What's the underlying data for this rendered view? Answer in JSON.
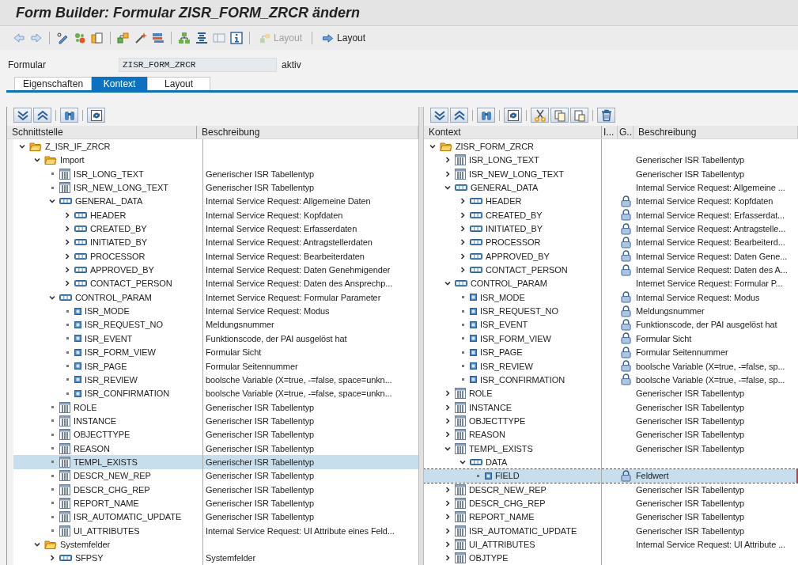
{
  "window": {
    "title": "Form Builder: Formular ZISR_FORM_ZRCR ändern"
  },
  "toolbar": {
    "buttons": [
      {
        "label": "Layout",
        "disabled": true
      },
      {
        "label": "Layout",
        "disabled": false
      }
    ]
  },
  "form": {
    "label": "Formular",
    "value": "ZISR_FORM_ZRCR",
    "status": "aktiv"
  },
  "tabs": [
    {
      "label": "Eigenschaften",
      "selected": false
    },
    {
      "label": "Kontext",
      "selected": true
    },
    {
      "label": "Layout",
      "selected": false
    }
  ],
  "interface_tree": {
    "columns": [
      "Schnittstelle",
      "Beschreibung"
    ],
    "nodes": [
      {
        "label": "Z_ISR_IF_ZRCR",
        "kind": "folder",
        "expandable": true,
        "expanded": true,
        "selected": false,
        "children": [
          {
            "label": "Import",
            "kind": "folder",
            "expandable": true,
            "expanded": true,
            "selected": false,
            "children": [
              {
                "label": "ISR_LONG_TEXT",
                "kind": "table",
                "expandable": false,
                "selected": false,
                "description": "Generischer ISR Tabellentyp"
              },
              {
                "label": "ISR_NEW_LONG_TEXT",
                "kind": "table",
                "expandable": false,
                "selected": false,
                "description": "Generischer ISR Tabellentyp"
              },
              {
                "label": "GENERAL_DATA",
                "kind": "structure",
                "expandable": true,
                "expanded": true,
                "selected": false,
                "description": "Internal Service Request: Allgemeine Daten",
                "children": [
                  {
                    "label": "HEADER",
                    "kind": "structure",
                    "expandable": true,
                    "expanded": false,
                    "selected": false,
                    "description": "Internal Service Request: Kopfdaten"
                  },
                  {
                    "label": "CREATED_BY",
                    "kind": "structure",
                    "expandable": true,
                    "expanded": false,
                    "selected": false,
                    "description": "Internal Service Request: Erfasserdaten"
                  },
                  {
                    "label": "INITIATED_BY",
                    "kind": "structure",
                    "expandable": true,
                    "expanded": false,
                    "selected": false,
                    "description": "Internal Service Request: Antragstellerdaten"
                  },
                  {
                    "label": "PROCESSOR",
                    "kind": "structure",
                    "expandable": true,
                    "expanded": false,
                    "selected": false,
                    "description": "Internal Service Request: Bearbeiterdaten"
                  },
                  {
                    "label": "APPROVED_BY",
                    "kind": "structure",
                    "expandable": true,
                    "expanded": false,
                    "selected": false,
                    "description": "Internal Service Request: Daten Genehmigender"
                  },
                  {
                    "label": "CONTACT_PERSON",
                    "kind": "structure",
                    "expandable": true,
                    "expanded": false,
                    "selected": false,
                    "description": "Internal Service Request: Daten des Ansprechp..."
                  }
                ]
              },
              {
                "label": "CONTROL_PARAM",
                "kind": "structure",
                "expandable": true,
                "expanded": true,
                "selected": false,
                "description": "Internet Service Request: Formular Parameter",
                "children": [
                  {
                    "label": "ISR_MODE",
                    "kind": "field",
                    "expandable": false,
                    "selected": false,
                    "description": "Internal Service Request: Modus"
                  },
                  {
                    "label": "ISR_REQUEST_NO",
                    "kind": "field",
                    "expandable": false,
                    "selected": false,
                    "description": "Meldungsnummer"
                  },
                  {
                    "label": "ISR_EVENT",
                    "kind": "field",
                    "expandable": false,
                    "selected": false,
                    "description": "Funktionscode, der PAI ausgelöst hat"
                  },
                  {
                    "label": "ISR_FORM_VIEW",
                    "kind": "field",
                    "expandable": false,
                    "selected": false,
                    "description": "Formular Sicht"
                  },
                  {
                    "label": "ISR_PAGE",
                    "kind": "field",
                    "expandable": false,
                    "selected": false,
                    "description": "Formular Seitennummer"
                  },
                  {
                    "label": "ISR_REVIEW",
                    "kind": "field",
                    "expandable": false,
                    "selected": false,
                    "description": "boolsche Variable (X=true, -=false, space=unkn..."
                  },
                  {
                    "label": "ISR_CONFIRMATION",
                    "kind": "field",
                    "expandable": false,
                    "selected": false,
                    "description": "boolsche Variable (X=true, -=false, space=unkn..."
                  }
                ]
              },
              {
                "label": "ROLE",
                "kind": "table",
                "expandable": false,
                "selected": false,
                "description": "Generischer ISR Tabellentyp"
              },
              {
                "label": "INSTANCE",
                "kind": "table",
                "expandable": false,
                "selected": false,
                "description": "Generischer ISR Tabellentyp"
              },
              {
                "label": "OBJECTTYPE",
                "kind": "table",
                "expandable": false,
                "selected": false,
                "description": "Generischer ISR Tabellentyp"
              },
              {
                "label": "REASON",
                "kind": "table",
                "expandable": false,
                "selected": false,
                "description": "Generischer ISR Tabellentyp"
              },
              {
                "label": "TEMPL_EXISTS",
                "kind": "table",
                "expandable": false,
                "selected": true,
                "description": "Generischer ISR Tabellentyp"
              },
              {
                "label": "DESCR_NEW_REP",
                "kind": "table",
                "expandable": false,
                "selected": false,
                "description": "Generischer ISR Tabellentyp"
              },
              {
                "label": "DESCR_CHG_REP",
                "kind": "table",
                "expandable": false,
                "selected": false,
                "description": "Generischer ISR Tabellentyp"
              },
              {
                "label": "REPORT_NAME",
                "kind": "table",
                "expandable": false,
                "selected": false,
                "description": "Generischer ISR Tabellentyp"
              },
              {
                "label": "ISR_AUTOMATIC_UPDATE",
                "kind": "table",
                "expandable": false,
                "selected": false,
                "description": "Generischer ISR Tabellentyp"
              },
              {
                "label": "UI_ATTRIBUTES",
                "kind": "table",
                "expandable": false,
                "selected": false,
                "description": "Internal Service Request: UI Attribute eines Feld..."
              }
            ]
          },
          {
            "label": "Systemfelder",
            "kind": "folder",
            "expandable": true,
            "expanded": true,
            "selected": false,
            "children": [
              {
                "label": "SFPSY",
                "kind": "structure",
                "expandable": true,
                "expanded": false,
                "selected": false,
                "description": "Systemfelder"
              }
            ]
          }
        ]
      }
    ]
  },
  "context_tree": {
    "columns": [
      "Kontext",
      "I...",
      "G..",
      "Beschreibung"
    ],
    "nodes": [
      {
        "label": "ZISR_FORM_ZRCR",
        "kind": "folder",
        "expandable": true,
        "expanded": true,
        "selected": false,
        "locked": false,
        "children": [
          {
            "label": "ISR_LONG_TEXT",
            "kind": "table",
            "expandable": true,
            "expanded": false,
            "selected": false,
            "locked": false,
            "description": "Generischer ISR Tabellentyp"
          },
          {
            "label": "ISR_NEW_LONG_TEXT",
            "kind": "table",
            "expandable": true,
            "expanded": false,
            "selected": false,
            "locked": false,
            "description": "Generischer ISR Tabellentyp"
          },
          {
            "label": "GENERAL_DATA",
            "kind": "structure",
            "expandable": true,
            "expanded": true,
            "selected": false,
            "locked": false,
            "description": "Internal Service Request: Allgemeine ...",
            "children": [
              {
                "label": "HEADER",
                "kind": "structure",
                "expandable": true,
                "expanded": false,
                "selected": false,
                "locked": true,
                "description": "Internal Service Request: Kopfdaten"
              },
              {
                "label": "CREATED_BY",
                "kind": "structure",
                "expandable": true,
                "expanded": false,
                "selected": false,
                "locked": true,
                "description": "Internal Service Request: Erfasserdat..."
              },
              {
                "label": "INITIATED_BY",
                "kind": "structure",
                "expandable": true,
                "expanded": false,
                "selected": false,
                "locked": true,
                "description": "Internal Service Request: Antragstelle..."
              },
              {
                "label": "PROCESSOR",
                "kind": "structure",
                "expandable": true,
                "expanded": false,
                "selected": false,
                "locked": true,
                "description": "Internal Service Request: Bearbeiterd..."
              },
              {
                "label": "APPROVED_BY",
                "kind": "structure",
                "expandable": true,
                "expanded": false,
                "selected": false,
                "locked": true,
                "description": "Internal Service Request: Daten Gene..."
              },
              {
                "label": "CONTACT_PERSON",
                "kind": "structure",
                "expandable": true,
                "expanded": false,
                "selected": false,
                "locked": true,
                "description": "Internal Service Request: Daten des A..."
              }
            ]
          },
          {
            "label": "CONTROL_PARAM",
            "kind": "structure",
            "expandable": true,
            "expanded": true,
            "selected": false,
            "locked": false,
            "description": "Internet Service Request: Formular P...",
            "children": [
              {
                "label": "ISR_MODE",
                "kind": "field",
                "expandable": false,
                "selected": false,
                "locked": true,
                "description": "Internal Service Request: Modus"
              },
              {
                "label": "ISR_REQUEST_NO",
                "kind": "field",
                "expandable": false,
                "selected": false,
                "locked": true,
                "description": "Meldungsnummer"
              },
              {
                "label": "ISR_EVENT",
                "kind": "field",
                "expandable": false,
                "selected": false,
                "locked": true,
                "description": "Funktionscode, der PAI ausgelöst hat"
              },
              {
                "label": "ISR_FORM_VIEW",
                "kind": "field",
                "expandable": false,
                "selected": false,
                "locked": true,
                "description": "Formular Sicht"
              },
              {
                "label": "ISR_PAGE",
                "kind": "field",
                "expandable": false,
                "selected": false,
                "locked": true,
                "description": "Formular Seitennummer"
              },
              {
                "label": "ISR_REVIEW",
                "kind": "field",
                "expandable": false,
                "selected": false,
                "locked": true,
                "description": "boolsche Variable (X=true, -=false, sp..."
              },
              {
                "label": "ISR_CONFIRMATION",
                "kind": "field",
                "expandable": false,
                "selected": false,
                "locked": true,
                "description": "boolsche Variable (X=true, -=false, sp..."
              }
            ]
          },
          {
            "label": "ROLE",
            "kind": "table",
            "expandable": true,
            "expanded": false,
            "selected": false,
            "locked": false,
            "description": "Generischer ISR Tabellentyp"
          },
          {
            "label": "INSTANCE",
            "kind": "table",
            "expandable": true,
            "expanded": false,
            "selected": false,
            "locked": false,
            "description": "Generischer ISR Tabellentyp"
          },
          {
            "label": "OBJECTTYPE",
            "kind": "table",
            "expandable": true,
            "expanded": false,
            "selected": false,
            "locked": false,
            "description": "Generischer ISR Tabellentyp"
          },
          {
            "label": "REASON",
            "kind": "table",
            "expandable": true,
            "expanded": false,
            "selected": false,
            "locked": false,
            "description": "Generischer ISR Tabellentyp"
          },
          {
            "label": "TEMPL_EXISTS",
            "kind": "table",
            "expandable": true,
            "expanded": true,
            "selected": false,
            "locked": false,
            "description": "Generischer ISR Tabellentyp",
            "children": [
              {
                "label": "DATA",
                "kind": "structure",
                "expandable": true,
                "expanded": true,
                "selected": false,
                "locked": false,
                "children": [
                  {
                    "label": "FIELD",
                    "kind": "field",
                    "expandable": false,
                    "selected": true,
                    "locked": true,
                    "description": "Feldwert"
                  }
                ]
              }
            ]
          },
          {
            "label": "DESCR_NEW_REP",
            "kind": "table",
            "expandable": true,
            "expanded": false,
            "selected": false,
            "locked": false,
            "description": "Generischer ISR Tabellentyp"
          },
          {
            "label": "DESCR_CHG_REP",
            "kind": "table",
            "expandable": true,
            "expanded": false,
            "selected": false,
            "locked": false,
            "description": "Generischer ISR Tabellentyp"
          },
          {
            "label": "REPORT_NAME",
            "kind": "table",
            "expandable": true,
            "expanded": false,
            "selected": false,
            "locked": false,
            "description": "Generischer ISR Tabellentyp"
          },
          {
            "label": "ISR_AUTOMATIC_UPDATE",
            "kind": "table",
            "expandable": true,
            "expanded": false,
            "selected": false,
            "locked": false,
            "description": "Generischer ISR Tabellentyp"
          },
          {
            "label": "UI_ATTRIBUTES",
            "kind": "table",
            "expandable": true,
            "expanded": false,
            "selected": false,
            "locked": false,
            "description": "Internal Service Request: UI Attribute ..."
          },
          {
            "label": "OBJTYPE",
            "kind": "table",
            "expandable": true,
            "expanded": false,
            "selected": false,
            "locked": false
          }
        ]
      }
    ]
  }
}
